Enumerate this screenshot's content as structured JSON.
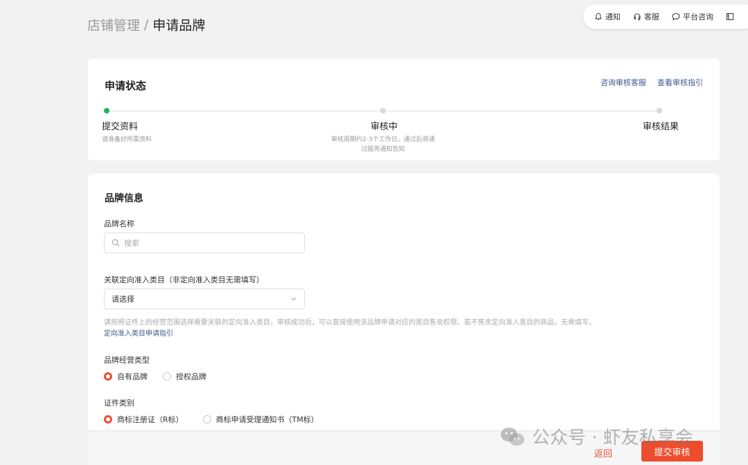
{
  "breadcrumb": {
    "parent": "店铺管理",
    "separator": "/",
    "current": "申请品牌"
  },
  "topbar": {
    "notify": "通知",
    "service": "客服",
    "consult": "平台咨询"
  },
  "status": {
    "title": "申请状态",
    "link_consult": "咨询审核客服",
    "link_guide": "查看审核指引",
    "steps": [
      {
        "label": "提交资料",
        "desc": "请准备好所需资料"
      },
      {
        "label": "审核中",
        "desc_line1": "审核周期约2-3个工作日，通过后将通",
        "desc_line2": "过服务通知告知"
      },
      {
        "label": "审核结果"
      }
    ]
  },
  "brand": {
    "title": "品牌信息",
    "name_label": "品牌名称",
    "search_placeholder": "搜索",
    "category_label": "关联定向准入类目（非定向准入类目无需填写）",
    "category_value": "请选择",
    "category_hint": "请按照证件上的经营范围选择需要关联的定向准入类目，审核成功后，可以直接使用该品牌申请对应的类目售卖权限。若不售卖定向准入类目的商品，无需填写。",
    "category_guide_link": "定向准入类目申请指引",
    "biz_type_label": "品牌经营类型",
    "biz_type_options": [
      "自有品牌",
      "授权品牌"
    ],
    "biz_type_selected": "自有品牌",
    "cert_label": "证件类别",
    "cert_options": [
      "商标注册证（R标）",
      "商标申请受理通知书（TM标）"
    ],
    "cert_selected": "商标注册证（R标）"
  },
  "footer": {
    "back": "返回",
    "submit": "提交审核"
  },
  "watermark": {
    "text": "公众号 · 虾友私享会"
  },
  "colors": {
    "accent": "#ee4d2d",
    "link": "#3a5a8c",
    "success": "#22b35e"
  }
}
